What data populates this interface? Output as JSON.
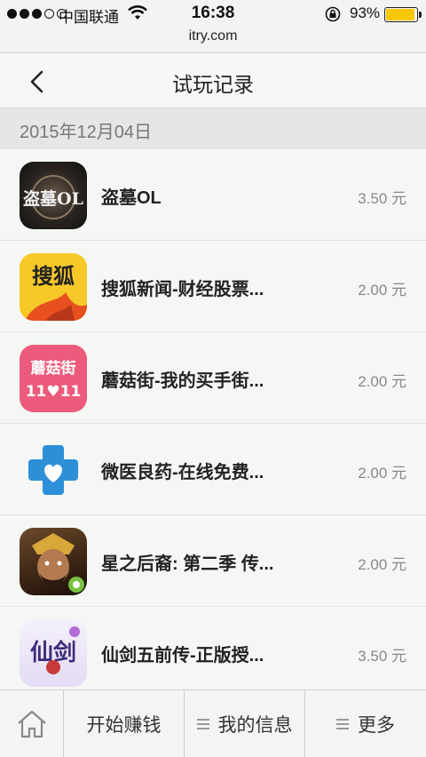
{
  "status_bar": {
    "carrier": "中国联通",
    "time": "16:38",
    "battery": "93%",
    "battery_level": 0.93
  },
  "browser": {
    "url": "itry.com"
  },
  "nav": {
    "title": "试玩记录",
    "back_icon": "chevron-left-icon"
  },
  "date_header": "2015年12月04日",
  "records": [
    {
      "name": "盗墓OL",
      "reward": "3.50 元",
      "icon_text": "盗墓OL"
    },
    {
      "name": "搜狐新闻-财经股票...",
      "reward": "2.00 元",
      "icon_text": "搜狐"
    },
    {
      "name": "蘑菇街-我的买手街...",
      "reward": "2.00 元",
      "icon_text_top": "蘑菇街",
      "icon_text_bottom": "11♥11"
    },
    {
      "name": "微医良药-在线免费...",
      "reward": "2.00 元"
    },
    {
      "name": "星之后裔: 第二季 传...",
      "reward": "2.00 元"
    },
    {
      "name": "仙剑五前传-正版授...",
      "reward": "3.50 元",
      "icon_text": "仙剑"
    }
  ],
  "tabbar": {
    "home_icon": "home-icon",
    "earn": "开始赚钱",
    "my_info": "我的信息",
    "more": "更多"
  },
  "colors": {
    "battery_fill": "#f5c800",
    "sohu_bg": "#f7c928",
    "mogujie_bg": "#ec5b7b",
    "weiyi_blue": "#2d8fd8"
  }
}
